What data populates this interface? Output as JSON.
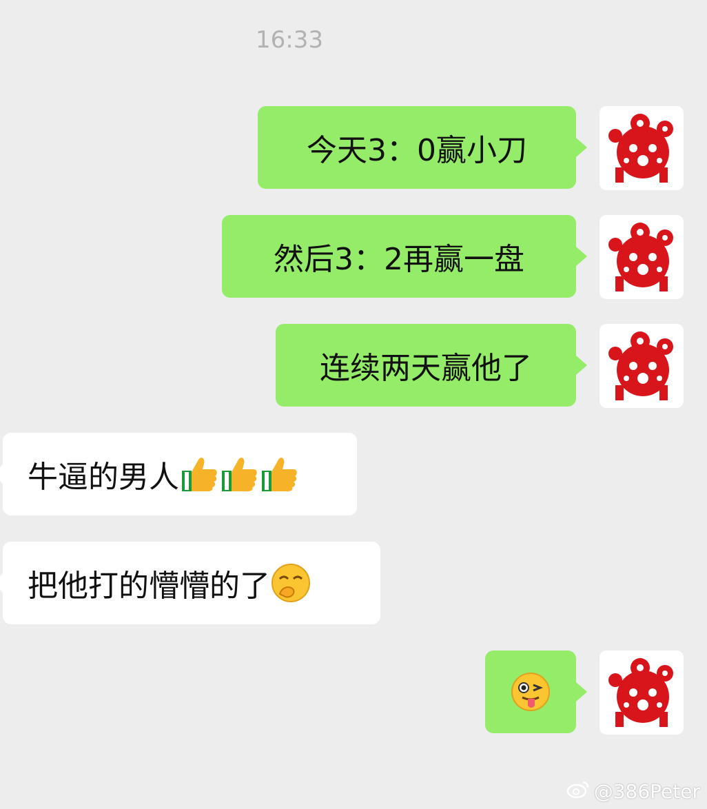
{
  "chat": {
    "timestamp": "16:33",
    "messages": [
      {
        "sender": "self",
        "text": "今天3：0赢小刀"
      },
      {
        "sender": "self",
        "text": "然后3：2再赢一盘"
      },
      {
        "sender": "self",
        "text": "连续两天赢他了"
      },
      {
        "sender": "other",
        "text": "牛逼的男人",
        "emojis": [
          "thumbs-up-icon",
          "thumbs-up-icon",
          "thumbs-up-icon"
        ]
      },
      {
        "sender": "other",
        "text": "把他打的懵懵的了",
        "emojis": [
          "shy-face-icon"
        ]
      },
      {
        "sender": "self",
        "text": "",
        "emojis": [
          "wink-tongue-face-icon"
        ]
      }
    ]
  },
  "watermark": {
    "text": "@386Peter",
    "icon": "weibo-icon"
  },
  "colors": {
    "background": "#ededed",
    "self_bubble": "#95ec69",
    "other_bubble": "#ffffff",
    "avatar_red": "#d8151b"
  }
}
